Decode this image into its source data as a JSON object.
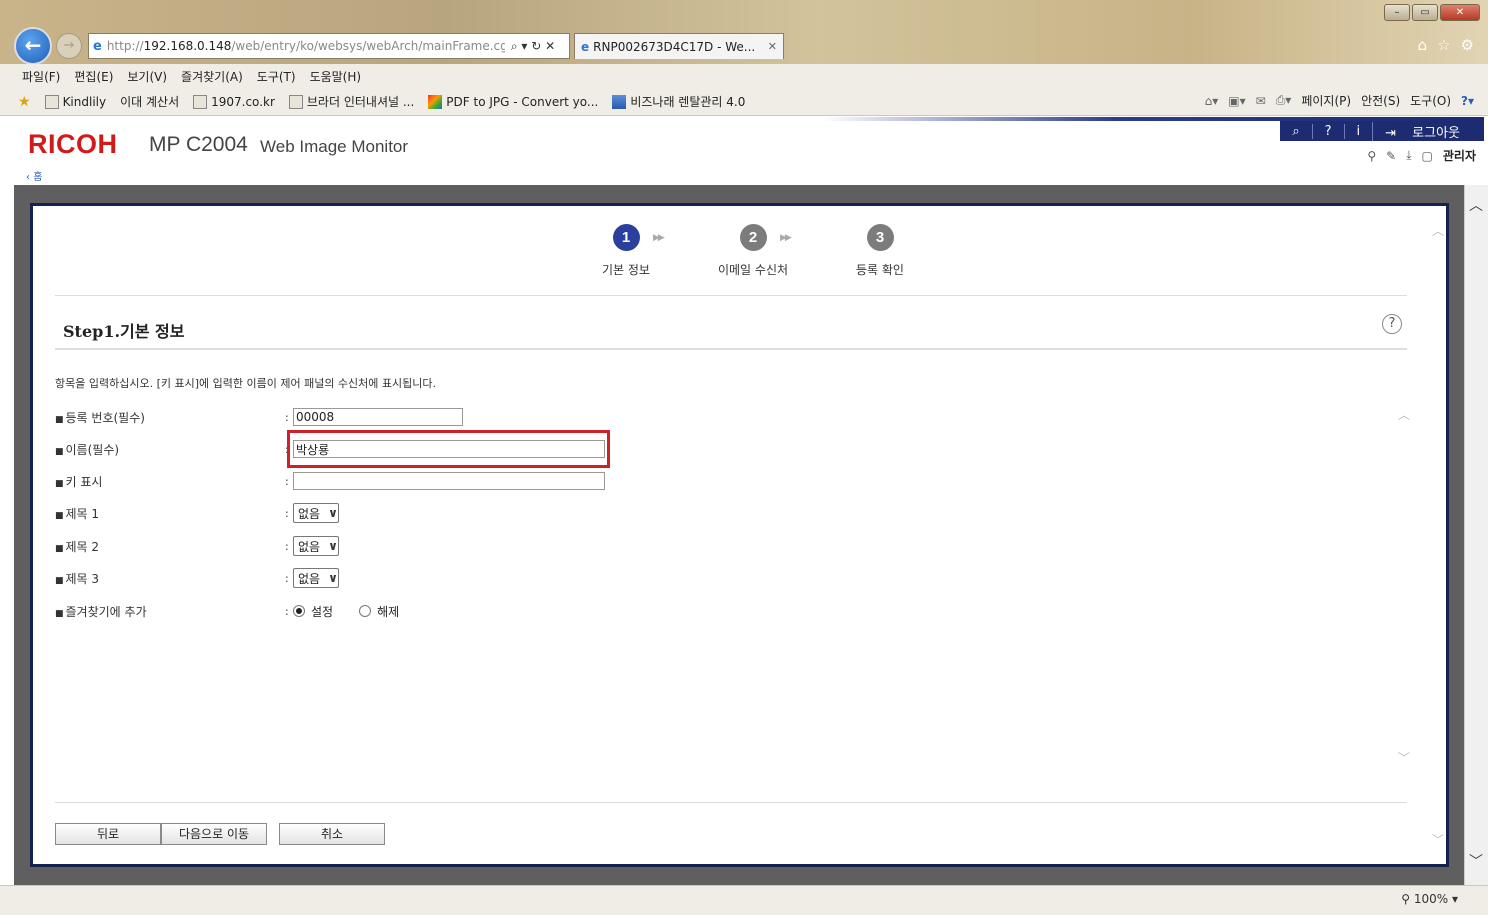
{
  "browser": {
    "url_prefix": "http://",
    "url_host": "192.168.0.148",
    "url_path": "/web/entry/ko/websys/webArch/mainFrame.cgi",
    "tab_title": "RNP002673D4C17D - We...",
    "menu": [
      "파일(F)",
      "편집(E)",
      "보기(V)",
      "즐겨찾기(A)",
      "도구(T)",
      "도움말(H)"
    ],
    "favorites": [
      "Kindlily",
      "이대 계산서",
      "1907.co.kr",
      "브라더 인터내셔널 ...",
      "PDF to JPG - Convert yo...",
      "비즈나래 렌탈관리 4.0"
    ],
    "commands": [
      "페이지(P)",
      "안전(S)",
      "도구(O)"
    ],
    "zoom": "100%"
  },
  "header": {
    "brand": "RICOH",
    "model": "MP C2004",
    "product": "Web Image Monitor",
    "logout": "로그아웃",
    "admin": "관리자",
    "breadcrumb": "홈"
  },
  "steps": [
    {
      "number": "1",
      "label": "기본 정보",
      "active": true
    },
    {
      "number": "2",
      "label": "이메일 수신처",
      "active": false
    },
    {
      "number": "3",
      "label": "등록 확인",
      "active": false
    }
  ],
  "section": {
    "title": "Step1.기본 정보",
    "instruction": "항목을 입력하십시오. [키 표시]에 입력한 이름이 제어 패널의 수신처에 표시됩니다."
  },
  "form": {
    "reg_number_label": "등록 번호(필수)",
    "reg_number_value": "00008",
    "name_label": "이름(필수)",
    "name_value": "박상룡",
    "key_display_label": "키 표시",
    "key_display_value": "",
    "title1_label": "제목 1",
    "title1_value": "없음",
    "title2_label": "제목 2",
    "title2_value": "없음",
    "title3_label": "제목 3",
    "title3_value": "없음",
    "favorite_label": "즐겨찾기에 추가",
    "favorite_on": "설정",
    "favorite_off": "해제"
  },
  "buttons": {
    "back": "뒤로",
    "next": "다음으로 이동",
    "cancel": "취소"
  }
}
